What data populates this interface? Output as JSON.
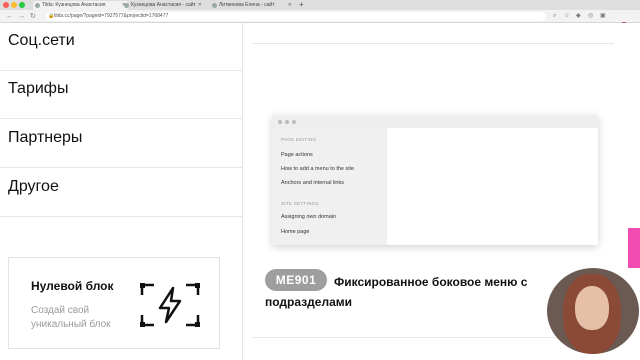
{
  "browser": {
    "tabs": [
      {
        "label": "Tilda: Кузнецова Анастасия",
        "active": true
      },
      {
        "label": "Кузнецова Анастасия - сайт",
        "active": false
      },
      {
        "label": "Литвинова Елена - сайт",
        "active": false
      }
    ],
    "new_tab": "+",
    "url": "tilda.cc/page/?pageid=7927577&projectid=1768477"
  },
  "sidebar": {
    "items": [
      {
        "label": "Соц.сети"
      },
      {
        "label": "Тарифы"
      },
      {
        "label": "Партнеры"
      },
      {
        "label": "Другое"
      }
    ],
    "zero_block": {
      "title": "Нулевой блок",
      "subtitle": "Создай свой уникальный блок",
      "icon": "lightning-frame-icon"
    }
  },
  "preview": {
    "sections": [
      {
        "heading": "PAGE EDITING",
        "links": [
          "Page actions",
          "How to add a menu to the site",
          "Anchors and internal links"
        ]
      },
      {
        "heading": "SITE SETTINGS",
        "links": [
          "Assigning own domain",
          "Home page"
        ]
      }
    ]
  },
  "block": {
    "code": "ME901",
    "title": "Фиксированное боковое меню с подразделами"
  },
  "colors": {
    "accent_pink": "#f14bb1",
    "badge_gray": "#9e9e9e"
  }
}
